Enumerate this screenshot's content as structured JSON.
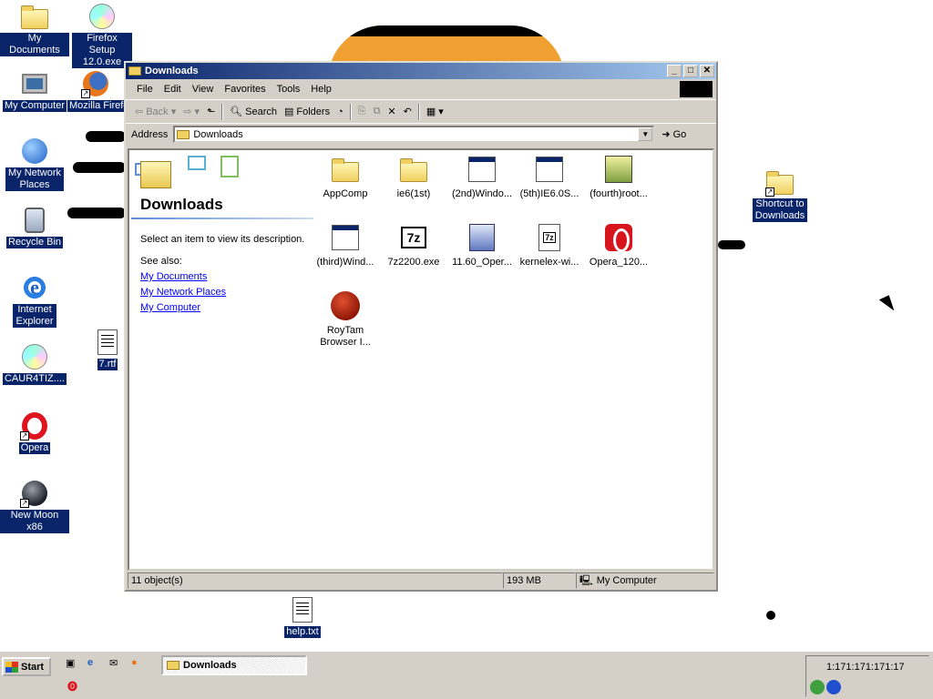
{
  "desktop": {
    "icons": [
      {
        "label": "My Documents",
        "icon": "folder"
      },
      {
        "label": "Firefox Setup 12.0.exe",
        "icon": "installer-cd"
      },
      {
        "label": "My Computer",
        "icon": "computer"
      },
      {
        "label": "Mozilla Firefox",
        "icon": "firefox"
      },
      {
        "label": "My Network Places",
        "icon": "network"
      },
      {
        "label": "Recycle Bin",
        "icon": "recycle-bin"
      },
      {
        "label": "Internet Explorer",
        "icon": "ie"
      },
      {
        "label": "7.rtf",
        "icon": "rtf-document"
      },
      {
        "label": "CAUR4TIZ....",
        "icon": "installer-cd"
      },
      {
        "label": "Opera",
        "icon": "opera"
      },
      {
        "label": "New Moon x86",
        "icon": "new-moon"
      },
      {
        "label": "Shortcut to Downloads",
        "icon": "folder-shortcut"
      },
      {
        "label": "help.txt",
        "icon": "text-document"
      }
    ]
  },
  "window": {
    "title": "Downloads",
    "menu": [
      "File",
      "Edit",
      "View",
      "Favorites",
      "Tools",
      "Help"
    ],
    "toolbar": {
      "back": "Back",
      "search": "Search",
      "folders": "Folders"
    },
    "address": {
      "label": "Address",
      "value": "Downloads",
      "go": "Go"
    },
    "left_pane": {
      "title": "Downloads",
      "description": "Select an item to view its description.",
      "see_also": "See also:",
      "links": [
        "My Documents",
        "My Network Places",
        "My Computer"
      ]
    },
    "files": [
      {
        "name": "AppComp",
        "icon": "folder"
      },
      {
        "name": "ie6(1st)",
        "icon": "folder"
      },
      {
        "name": "(2nd)Windo...",
        "icon": "window-app"
      },
      {
        "name": "(5th)IE6.0S...",
        "icon": "window-app"
      },
      {
        "name": "(fourth)root...",
        "icon": "installer"
      },
      {
        "name": "(third)Wind...",
        "icon": "window-app"
      },
      {
        "name": "7z2200.exe",
        "icon": "7zip"
      },
      {
        "name": "11.60_Oper...",
        "icon": "installer-doc"
      },
      {
        "name": "kernelex-wi...",
        "icon": "7zip-doc"
      },
      {
        "name": "Opera_120...",
        "icon": "opera-red"
      },
      {
        "name": "RoyTam Browser I...",
        "icon": "red-ball"
      }
    ],
    "status": {
      "objects": "11 object(s)",
      "size": "193 MB",
      "zone": "My Computer"
    }
  },
  "taskbar": {
    "start": "Start",
    "task": "Downloads",
    "clock": "1:171:171:171:17"
  },
  "colors": {
    "desktop_bg": "#ffffff",
    "titlebar_start": "#0a246a",
    "titlebar_end": "#a6caf0",
    "chrome": "#d4d0c8",
    "selection": "#0a246a"
  }
}
